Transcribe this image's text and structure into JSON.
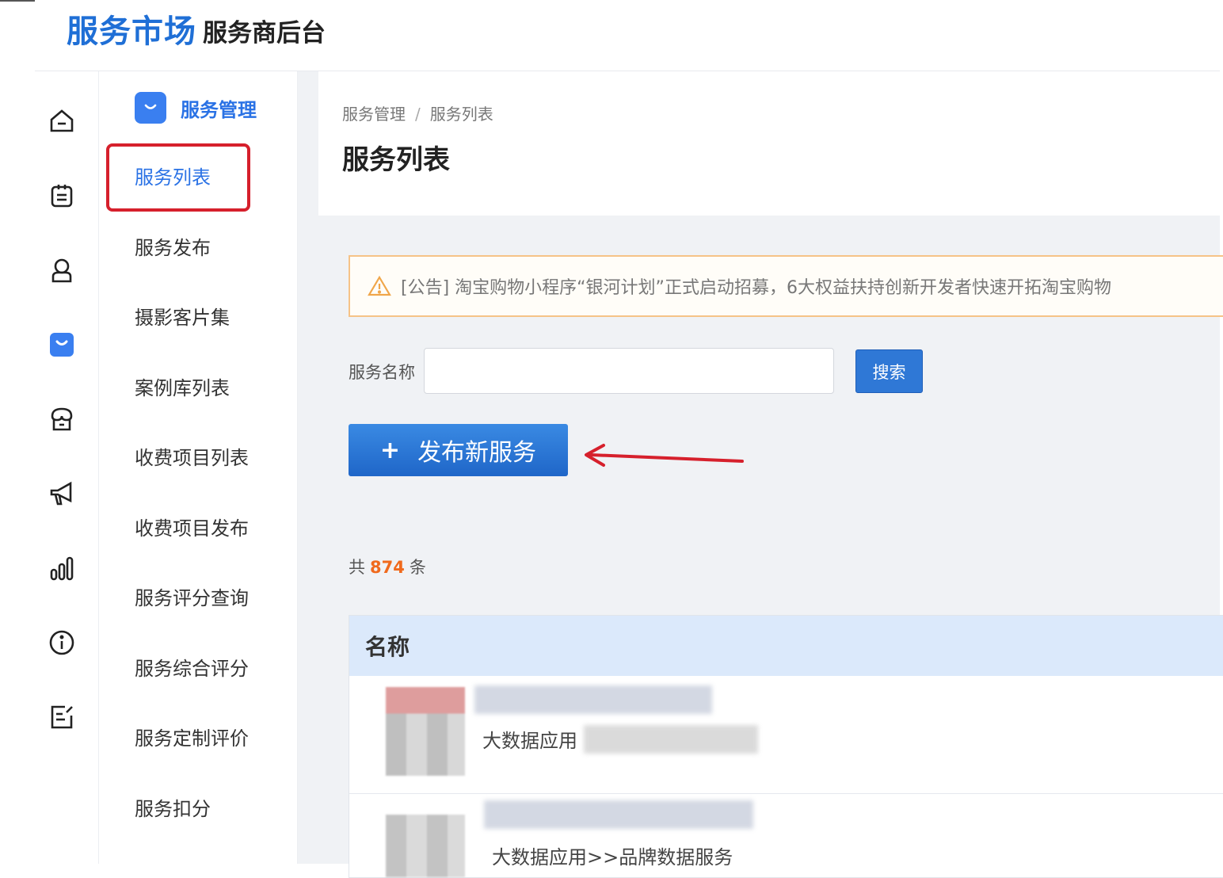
{
  "header": {
    "logo": "服务市场",
    "subtitle": "服务商后台"
  },
  "rail": {
    "icons": [
      "home-icon",
      "clipboard-icon",
      "user-icon",
      "shopping-bag-icon",
      "store-icon",
      "megaphone-icon",
      "bar-chart-icon",
      "info-icon",
      "edit-list-icon"
    ]
  },
  "submenu": {
    "title": "服务管理",
    "items": [
      {
        "label": "服务列表"
      },
      {
        "label": "服务发布"
      },
      {
        "label": "摄影客片集"
      },
      {
        "label": "案例库列表"
      },
      {
        "label": "收费项目列表"
      },
      {
        "label": "收费项目发布"
      },
      {
        "label": "服务评分查询"
      },
      {
        "label": "服务综合评分"
      },
      {
        "label": "服务定制评价"
      },
      {
        "label": "服务扣分"
      }
    ]
  },
  "breadcrumb": {
    "parent": "服务管理",
    "separator": "/",
    "current": "服务列表"
  },
  "page": {
    "title": "服务列表"
  },
  "notice": {
    "text": "[公告] 淘宝购物小程序“银河计划”正式启动招募，6大权益扶持创新开发者快速开拓淘宝购物"
  },
  "search": {
    "label": "服务名称",
    "value": "",
    "button": "搜索"
  },
  "publish": {
    "label": "发布新服务"
  },
  "total": {
    "prefix": "共",
    "count": "874",
    "suffix": "条"
  },
  "table": {
    "columns": [
      "名称"
    ],
    "rows": [
      {
        "category": "大数据应用"
      },
      {
        "category": "大数据应用>>品牌数据服务"
      }
    ]
  },
  "colors": {
    "accent": "#2a72e5",
    "annotation": "#d6202c",
    "count": "#f06a1d"
  }
}
